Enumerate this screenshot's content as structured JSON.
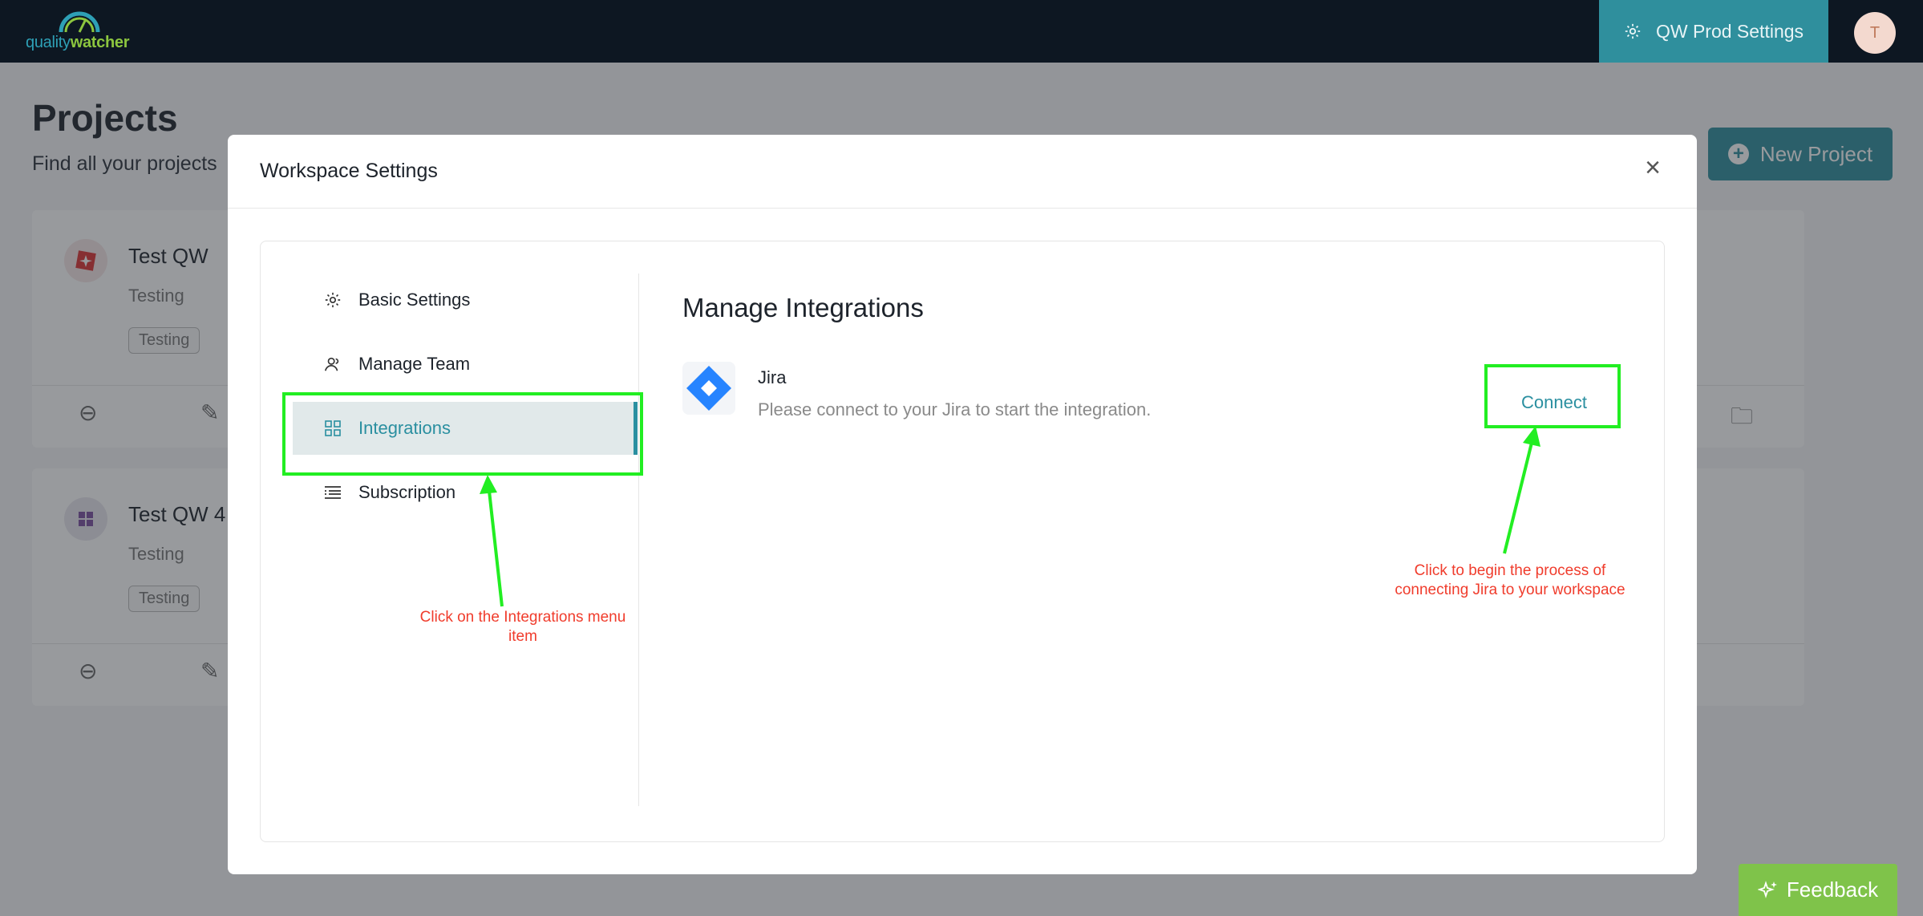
{
  "topbar": {
    "logo_text_1": "quality",
    "logo_text_2": "watcher",
    "settings_label": "QW Prod Settings",
    "avatar_initial": "T"
  },
  "page": {
    "title": "Projects",
    "subtitle": "Find all your projects",
    "new_project_label": "New Project"
  },
  "projects": [
    {
      "name": "Test QW",
      "description": "Testing",
      "tag": "Testing"
    },
    {
      "name": "Test QW 4",
      "description": "Testing",
      "tag": "Testing"
    }
  ],
  "modal": {
    "title": "Workspace Settings",
    "menu": [
      {
        "label": "Basic Settings",
        "icon": "gear-icon"
      },
      {
        "label": "Manage Team",
        "icon": "team-icon"
      },
      {
        "label": "Integrations",
        "icon": "grid-icon",
        "active": true
      },
      {
        "label": "Subscription",
        "icon": "list-icon"
      }
    ],
    "content_title": "Manage Integrations",
    "integration": {
      "name": "Jira",
      "description": "Please connect to your Jira to start the integration.",
      "action": "Connect"
    }
  },
  "annotations": {
    "integrations_note": "Click on the Integrations menu item",
    "connect_note": "Click to begin the process of connecting Jira to your workspace"
  },
  "feedback_label": "Feedback",
  "colors": {
    "accent": "#2f8f9d",
    "highlight": "#22ee22",
    "annotation_text": "#f03c2c",
    "feedback": "#7fc34a"
  }
}
